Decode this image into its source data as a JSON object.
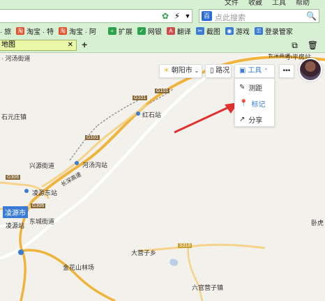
{
  "browser": {
    "menu": [
      "文件",
      "收藏",
      "工具",
      "帮助"
    ],
    "search_placeholder": "点此搜索",
    "bookmarks": [
      {
        "label": "· 旅",
        "color": "#444444"
      },
      {
        "label": "淘宝 · 特",
        "color": "#e0502a"
      },
      {
        "label": "淘宝 · 阿",
        "color": "#e0502a"
      },
      {
        "label": "扩展",
        "color": "#2ba24c"
      },
      {
        "label": "网银",
        "color": "#2ba24c"
      },
      {
        "label": "翻译",
        "color": "#d04a4a"
      },
      {
        "label": "截图",
        "color": "#3a7bd5"
      },
      {
        "label": "游戏",
        "color": "#3a7bd5"
      },
      {
        "label": "登录管家",
        "color": "#3a7bd5"
      }
    ],
    "tab_label": "地图"
  },
  "map_ui": {
    "city_label": "朝阳市",
    "traffic_label": "路况",
    "tools_label": "工具",
    "tools_menu": [
      {
        "label": "测距",
        "icon": "ruler-icon"
      },
      {
        "label": "标记",
        "icon": "pin-icon"
      },
      {
        "label": "分享",
        "icon": "share-icon"
      }
    ]
  },
  "map_labels": [
    {
      "text": "· 河汤街道"
    },
    {
      "text": "石元庄镇"
    },
    {
      "text": "红石站"
    },
    {
      "text": "G101"
    },
    {
      "text": "G101"
    },
    {
      "text": "G101"
    },
    {
      "text": "河汤沟站"
    },
    {
      "text": "长深高速"
    },
    {
      "text": "兴源街道"
    },
    {
      "text": "G306"
    },
    {
      "text": "凌源东站"
    },
    {
      "text": "凌源市"
    },
    {
      "text": "G306"
    },
    {
      "text": "凌源站"
    },
    {
      "text": "东城街道"
    },
    {
      "text": "大营子乡"
    },
    {
      "text": "S318"
    },
    {
      "text": "金花山林场"
    },
    {
      "text": "六官营子镇"
    },
    {
      "text": "小平房站"
    },
    {
      "text": "卧虎"
    },
    {
      "text": "长深高速"
    }
  ],
  "colors": {
    "highway": "#f0b43c",
    "national_road": "#f5d38a",
    "annotation_arrow": "#e03030",
    "accent_blue": "#3a7bd5",
    "tab_bg": "#e9f7a6"
  }
}
